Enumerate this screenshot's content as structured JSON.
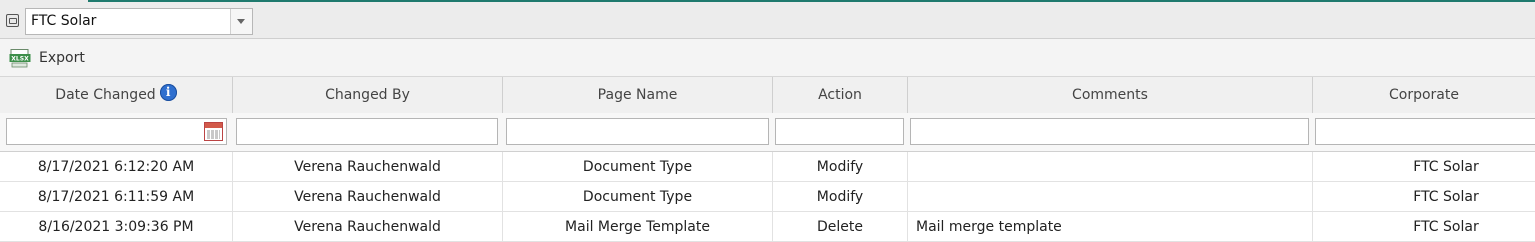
{
  "company_selector": {
    "value": "FTC Solar"
  },
  "toolbar": {
    "export_label": "Export"
  },
  "columns": [
    {
      "key": "date_changed",
      "label": "Date Changed"
    },
    {
      "key": "changed_by",
      "label": "Changed By"
    },
    {
      "key": "page_name",
      "label": "Page Name"
    },
    {
      "key": "action",
      "label": "Action"
    },
    {
      "key": "comments",
      "label": "Comments"
    },
    {
      "key": "corporate",
      "label": "Corporate"
    }
  ],
  "rows": [
    {
      "date_changed": "8/17/2021 6:12:20 AM",
      "changed_by": "Verena Rauchenwald",
      "page_name": "Document Type",
      "action": "Modify",
      "comments": "",
      "corporate": "FTC Solar"
    },
    {
      "date_changed": "8/17/2021 6:11:59 AM",
      "changed_by": "Verena Rauchenwald",
      "page_name": "Document Type",
      "action": "Modify",
      "comments": "",
      "corporate": "FTC Solar"
    },
    {
      "date_changed": "8/16/2021 3:09:36 PM",
      "changed_by": "Verena Rauchenwald",
      "page_name": "Mail Merge Template",
      "action": "Delete",
      "comments": "Mail merge template",
      "corporate": "FTC Solar"
    }
  ],
  "icons": {
    "company": "company-icon",
    "export": "excel-export-icon",
    "info": "info-icon",
    "calendar": "calendar-icon"
  },
  "colors": {
    "accent": "#1f7a6e",
    "info": "#2f6fcf",
    "header_bg": "#f0f0f0"
  }
}
